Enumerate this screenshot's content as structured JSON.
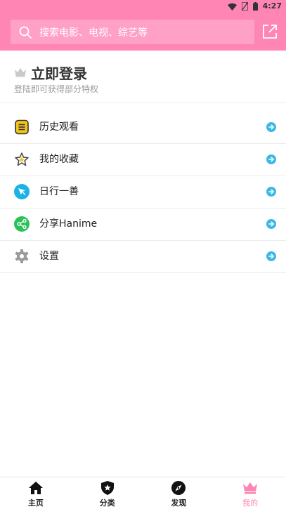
{
  "status_bar": {
    "time": "4:27",
    "icons": [
      "wifi-icon",
      "no-sim-icon",
      "battery-icon"
    ]
  },
  "header": {
    "search": {
      "placeholder": "搜索电影、电视、综艺等",
      "icon": "search-icon"
    },
    "share_icon": "external-link-icon"
  },
  "login": {
    "title": "立即登录",
    "subtitle": "登陆即可获得部分特权",
    "icon": "crown-icon"
  },
  "menu": {
    "items": [
      {
        "label": "历史观看",
        "icon": "history-note-icon"
      },
      {
        "label": "我的收藏",
        "icon": "star-icon"
      },
      {
        "label": "日行一善",
        "icon": "paper-plane-icon"
      },
      {
        "label": "分享Hanime",
        "icon": "share-icon"
      },
      {
        "label": "设置",
        "icon": "gear-icon"
      }
    ],
    "arrow_icon": "arrow-right-circle-icon"
  },
  "bottom_nav": {
    "items": [
      {
        "label": "主页",
        "icon": "home-icon",
        "active": false
      },
      {
        "label": "分类",
        "icon": "shield-star-icon",
        "active": false
      },
      {
        "label": "发现",
        "icon": "compass-icon",
        "active": false
      },
      {
        "label": "我的",
        "icon": "crown-icon",
        "active": true
      }
    ]
  },
  "colors": {
    "brand_pink": "#ff85b4",
    "arrow_blue": "#3bb8e8",
    "green": "#2bc25a",
    "cyan": "#1ab3e6"
  }
}
